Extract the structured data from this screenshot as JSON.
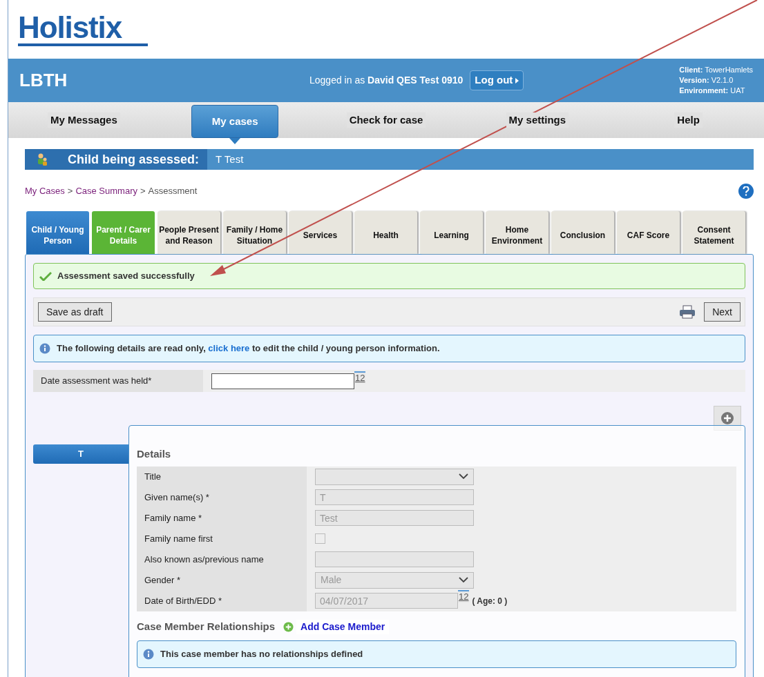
{
  "logo": "Holistix",
  "header": {
    "org": "LBTH",
    "logged_in_prefix": "Logged in as ",
    "user": "David QES Test 0910",
    "logout": "Log out",
    "info": [
      {
        "label": "Client:",
        "value": "TowerHamlets"
      },
      {
        "label": "Version:",
        "value": "V2.1.0"
      },
      {
        "label": "Environment:",
        "value": "UAT"
      }
    ]
  },
  "nav": [
    {
      "label": "My Messages",
      "selected": false
    },
    {
      "label": "My cases",
      "selected": true
    },
    {
      "label": "Check for case",
      "selected": false
    },
    {
      "label": "My settings",
      "selected": false
    },
    {
      "label": "Help",
      "selected": false
    }
  ],
  "child_bar": {
    "label": "Child being assessed:",
    "name": "T Test"
  },
  "breadcrumb": [
    {
      "label": "My Cases",
      "link": true
    },
    {
      "separator": ">",
      "label": "Case Summary",
      "link": true
    },
    {
      "separator": ">",
      "label": "Assessment",
      "link": false
    }
  ],
  "tabs": [
    {
      "label": "Child / Young Person",
      "selected": true,
      "complete": false
    },
    {
      "label": "Parent / Carer Details",
      "selected": false,
      "complete": true
    },
    {
      "label": "People Present and Reason",
      "selected": false,
      "complete": false
    },
    {
      "label": "Family / Home Situation",
      "selected": false,
      "complete": false
    },
    {
      "label": "Services",
      "selected": false,
      "complete": false
    },
    {
      "label": "Health",
      "selected": false,
      "complete": false
    },
    {
      "label": "Learning",
      "selected": false,
      "complete": false
    },
    {
      "label": "Home Environment",
      "selected": false,
      "complete": false
    },
    {
      "label": "Conclusion",
      "selected": false,
      "complete": false
    },
    {
      "label": "CAF Score",
      "selected": false,
      "complete": false
    },
    {
      "label": "Consent Statement",
      "selected": false,
      "complete": false
    }
  ],
  "success_message": "Assessment saved successfully",
  "toolbar": {
    "save": "Save as draft",
    "next": "Next"
  },
  "info_message": {
    "before": "The following details are read only, ",
    "link": "click here",
    "after": " to edit the child / young person information."
  },
  "date_held": {
    "label": "Date assessment was held*",
    "calendar": "12"
  },
  "member_tab": {
    "label": "T",
    "selected": true
  },
  "details": {
    "heading": "Details",
    "fields": [
      {
        "kind": "select",
        "label": "Title"
      },
      {
        "kind": "text",
        "label": "Given name(s) *",
        "value": "T"
      },
      {
        "kind": "text",
        "label": "Family name *",
        "value": "Test"
      },
      {
        "kind": "checkbox",
        "label": "Family name first",
        "checked": false
      },
      {
        "kind": "text",
        "label": "Also known as/previous name"
      },
      {
        "kind": "select",
        "label": "Gender *",
        "value": "Male"
      },
      {
        "kind": "date",
        "label": "Date of Birth/EDD *",
        "value": "04/07/2017",
        "calendar": "12",
        "note": "( Age: 0 )"
      }
    ]
  },
  "relationships": {
    "heading": "Case Member Relationships",
    "add": "Add Case Member",
    "message": "This case member has no relationships defined"
  }
}
